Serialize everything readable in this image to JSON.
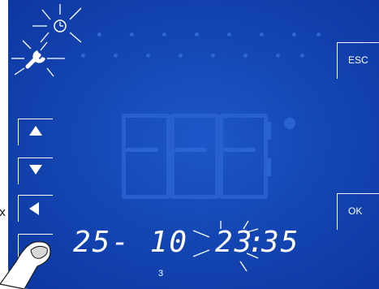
{
  "buttons": {
    "esc_label": "ESC",
    "ok_label": "OK"
  },
  "icons": {
    "clock": "clock-icon",
    "wrench": "wrench-icon",
    "up": "arrow-up-icon",
    "down": "arrow-down-icon",
    "left": "arrow-left-icon",
    "blank": "blank-key"
  },
  "display": {
    "date": "25- 10",
    "time_hours": "23",
    "time_separator": ":",
    "time_minutes": "35",
    "page_number": "3"
  },
  "colors": {
    "screen": "#1447b4",
    "ghost_segments": "#2a63d3",
    "foreground": "#ffffff"
  }
}
